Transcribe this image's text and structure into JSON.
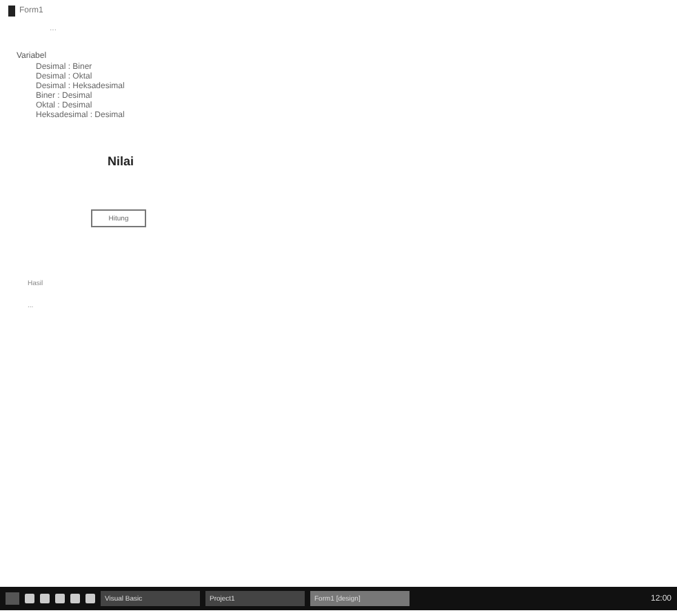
{
  "window": {
    "title": "Form1",
    "subtitle": "..."
  },
  "list": {
    "heading": "Variabel",
    "items": [
      "Desimal : Biner",
      "Desimal : Oktal",
      "Desimal : Heksadesimal",
      "Biner : Desimal",
      "Oktal : Desimal",
      "Heksadesimal : Desimal"
    ]
  },
  "value_label": "Nilai",
  "convert_button": "Hitung",
  "results": [
    "Hasil",
    "..."
  ],
  "taskbar": {
    "tasks": [
      {
        "label": "Visual Basic",
        "selected": false
      },
      {
        "label": "Project1",
        "selected": false
      },
      {
        "label": "Form1 [design]",
        "selected": true
      }
    ],
    "clock": "12:00"
  }
}
